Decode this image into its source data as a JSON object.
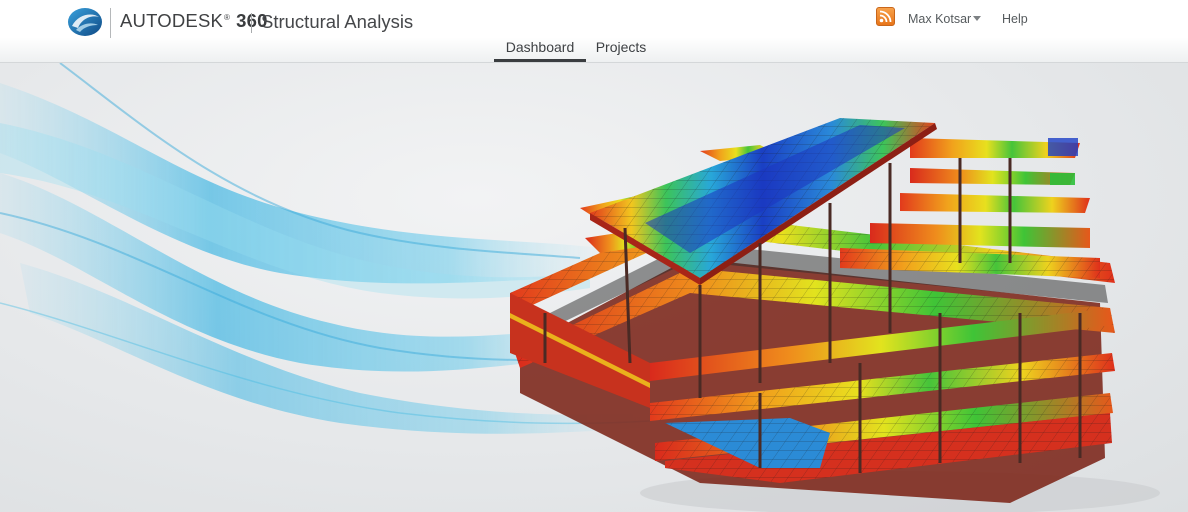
{
  "header": {
    "brand_name": "AUTODESK",
    "brand_reg": "®",
    "brand_number": "360",
    "product_name": "Structural Analysis",
    "user_name": "Max Kotsar",
    "help_label": "Help",
    "rss_icon": "rss-icon"
  },
  "nav": {
    "tabs": [
      {
        "label": "Dashboard",
        "active": true
      },
      {
        "label": "Projects",
        "active": false
      }
    ]
  },
  "hero": {
    "image": "building-structural-analysis-render",
    "colors": {
      "accent_blue": "#2aa3d8",
      "stress_red": "#d62a1e",
      "stress_green": "#3fc437"
    }
  }
}
